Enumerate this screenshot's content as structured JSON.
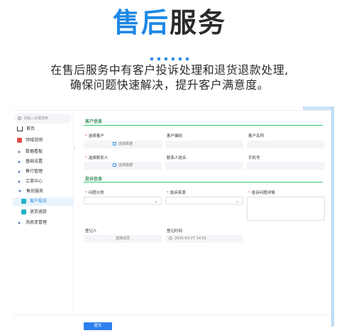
{
  "promo": {
    "title_part1": "售后",
    "title_part2": "服务",
    "desc_line1": "在售后服务中有客户投诉处理和退货退款处理,",
    "desc_line2": "确保问题快速解决，提升客户满意度。"
  },
  "sidebar": {
    "search_placeholder": "请输入关键搜索",
    "items": [
      {
        "label": "首页"
      },
      {
        "label": "领域说明"
      },
      {
        "label": "数据看板"
      },
      {
        "label": "基础设置"
      },
      {
        "label": "售行管理"
      },
      {
        "label": "工单中心"
      },
      {
        "label": "售后服务"
      },
      {
        "label": "客户投诉"
      },
      {
        "label": "退货退款"
      },
      {
        "label": "消息变管理"
      }
    ]
  },
  "form": {
    "section_customer": "客户信息",
    "select_customer_label": "选择客户",
    "select_customer_btn": "选择数据",
    "customer_code_label": "客户编码",
    "customer_name_label": "客户名称",
    "select_contact_label": "选择联系人",
    "select_contact_btn": "选择数据",
    "contact_name_label": "联系人姓名",
    "phone_label": "手机号",
    "section_complaint": "投诉信息",
    "issue_type_label": "问题分类",
    "complaint_source_label": "投诉来源",
    "complaint_detail_label": "投诉问题详情",
    "registrant_label": "登记人",
    "registrant_value": "选择成员",
    "register_time_label": "登记时间",
    "register_time_value": "2025-03-27 14:21"
  },
  "footer": {
    "submit_label": "提交"
  }
}
